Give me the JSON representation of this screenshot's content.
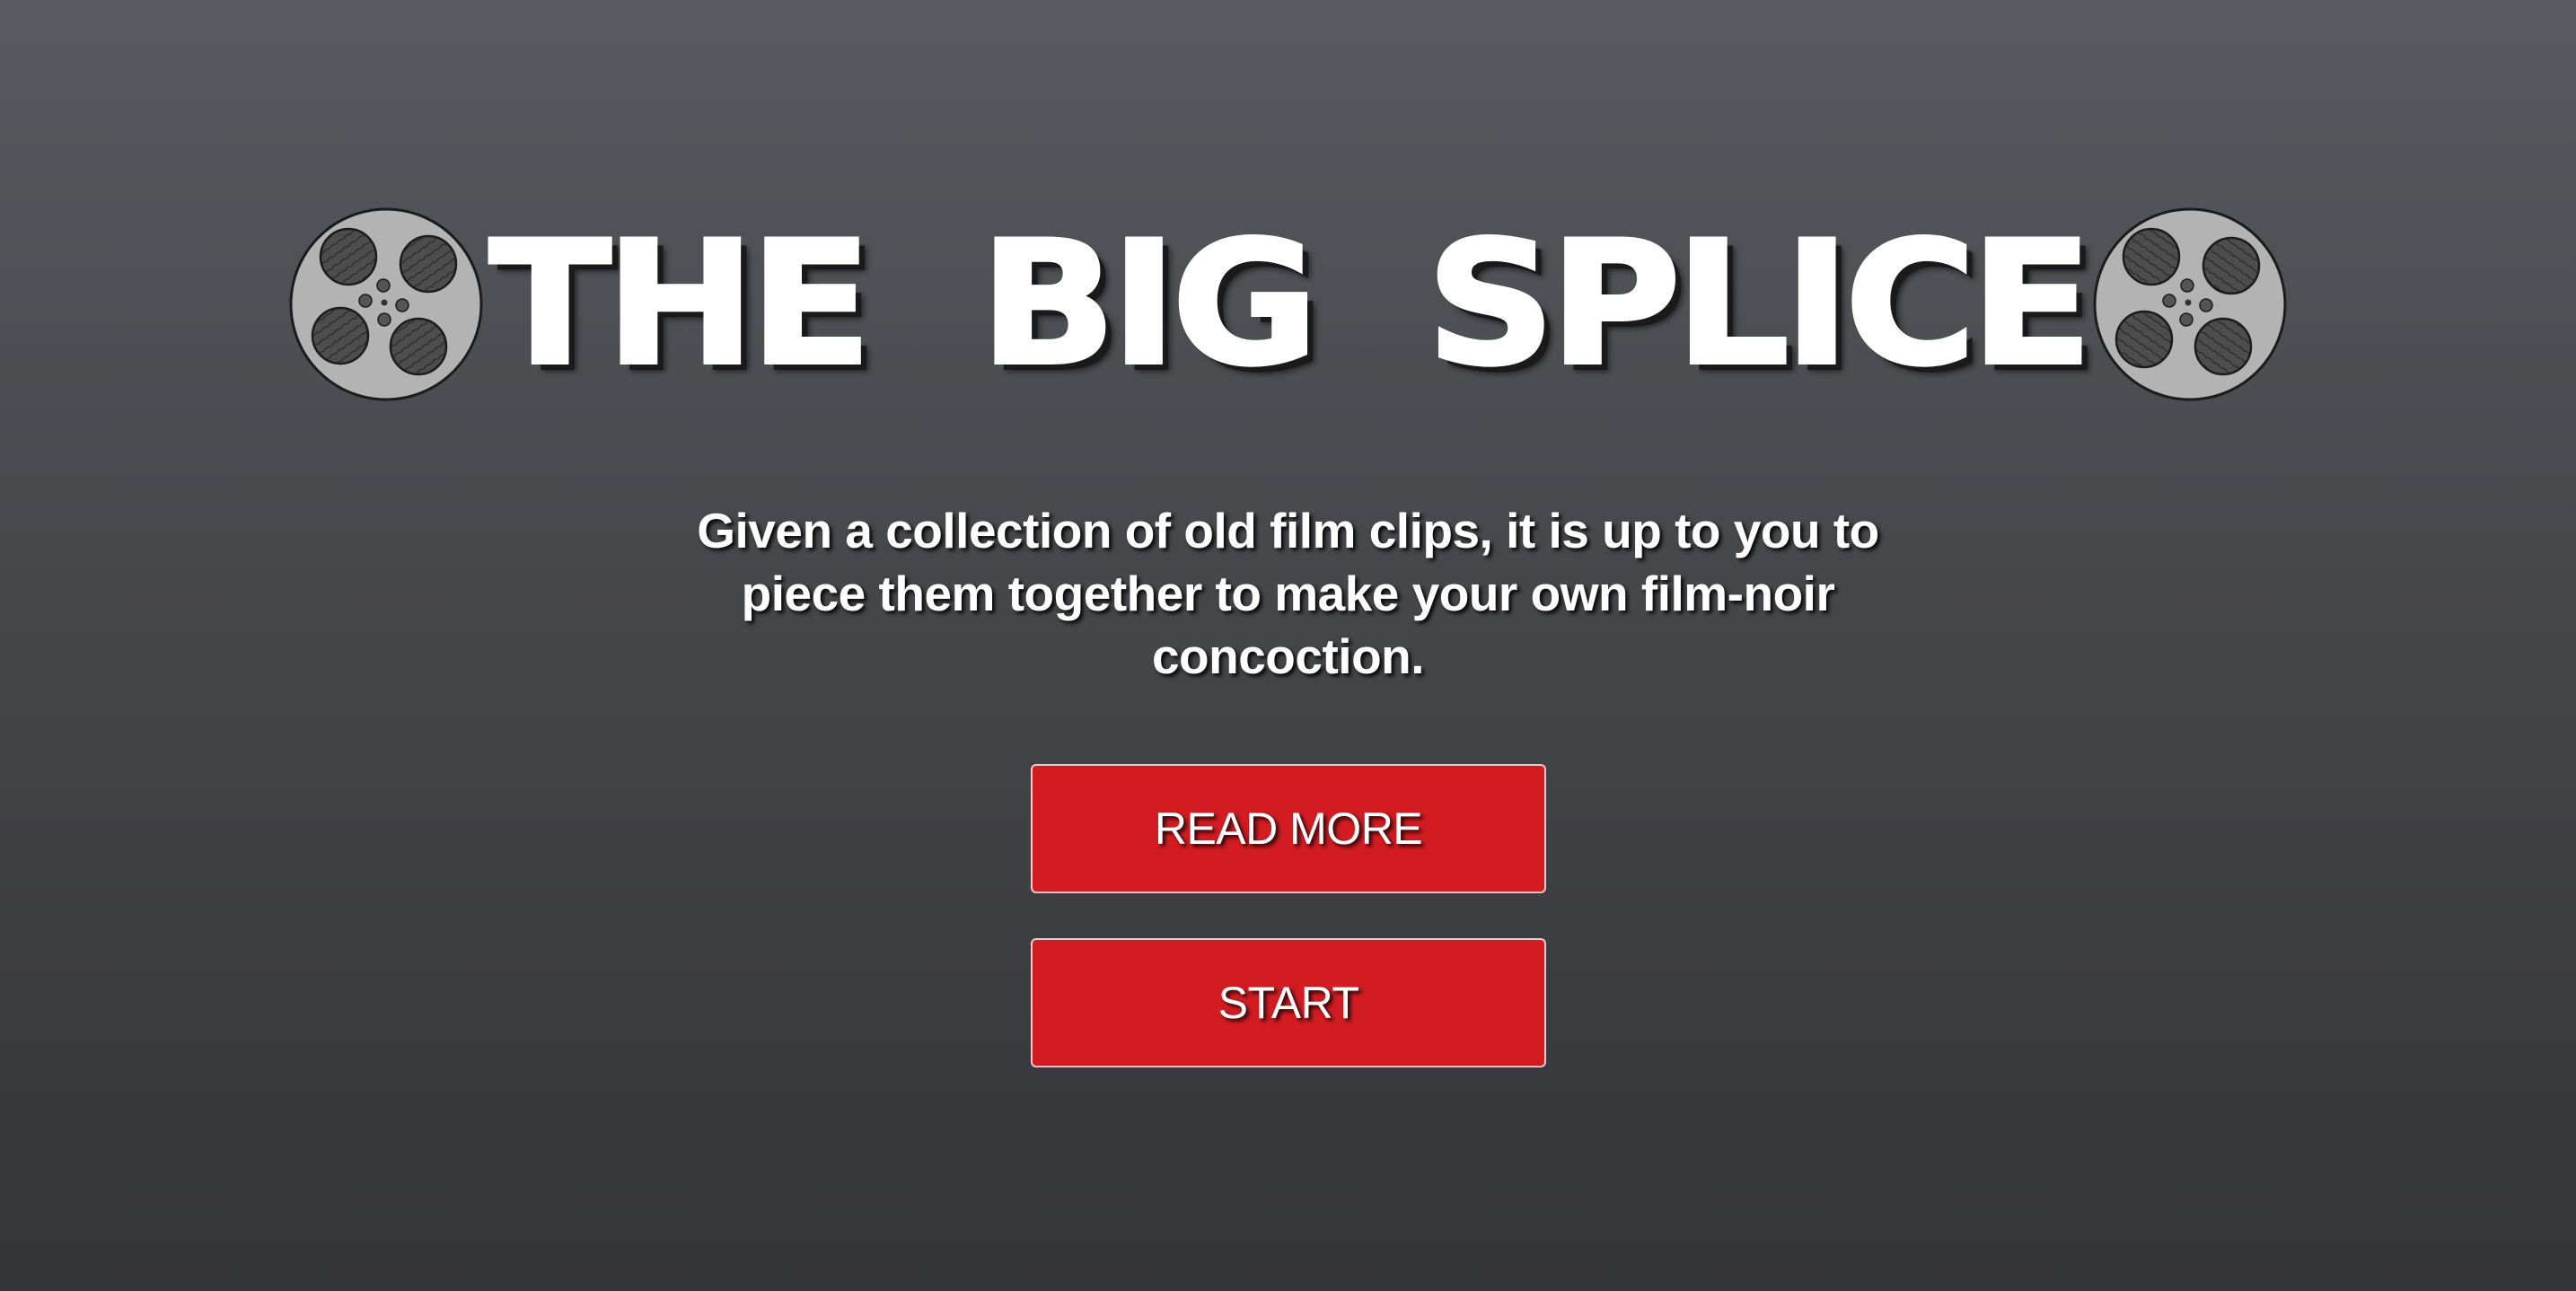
{
  "header": {
    "title": "THE BIG SPLICE",
    "left_icon": "film-reel-icon",
    "right_icon": "film-reel-icon"
  },
  "description": "Given a collection of old film clips, it is up to you to piece them together to make your own film-noir concoction.",
  "buttons": {
    "read_more": "READ MORE",
    "start": "START"
  },
  "colors": {
    "background_top": "#585a5f",
    "background_bottom": "#333437",
    "button_red": "#d21c22",
    "reel_gray": "#b3b3b3",
    "reel_hole": "#4a4a4a"
  }
}
